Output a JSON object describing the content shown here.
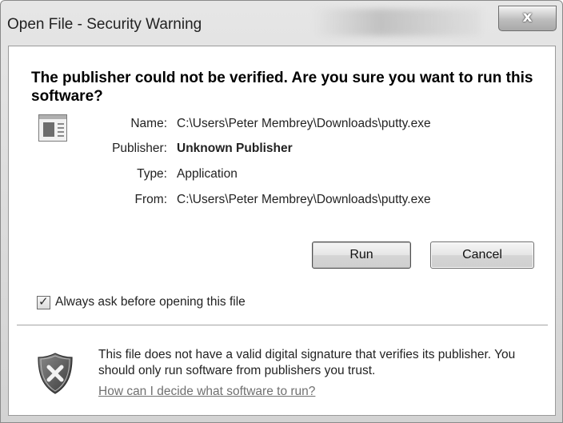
{
  "window": {
    "title": "Open File - Security Warning",
    "close_label": "x"
  },
  "heading": "The publisher could not be verified.  Are you sure you want to run this software?",
  "file_icon": "application-window-icon",
  "details": {
    "name_label": "Name:",
    "name_value": "C:\\Users\\Peter Membrey\\Downloads\\putty.exe",
    "publisher_label": "Publisher:",
    "publisher_value": "Unknown Publisher",
    "type_label": "Type:",
    "type_value": "Application",
    "from_label": "From:",
    "from_value": "C:\\Users\\Peter Membrey\\Downloads\\putty.exe"
  },
  "buttons": {
    "run": "Run",
    "cancel": "Cancel"
  },
  "checkbox": {
    "checked": true,
    "label": "Always ask before opening this file"
  },
  "warning": {
    "icon": "shield-x-icon",
    "text": "This file does not have a valid digital signature that verifies its publisher.  You should only run software from publishers you trust.",
    "link": "How can I decide what software to run?"
  }
}
